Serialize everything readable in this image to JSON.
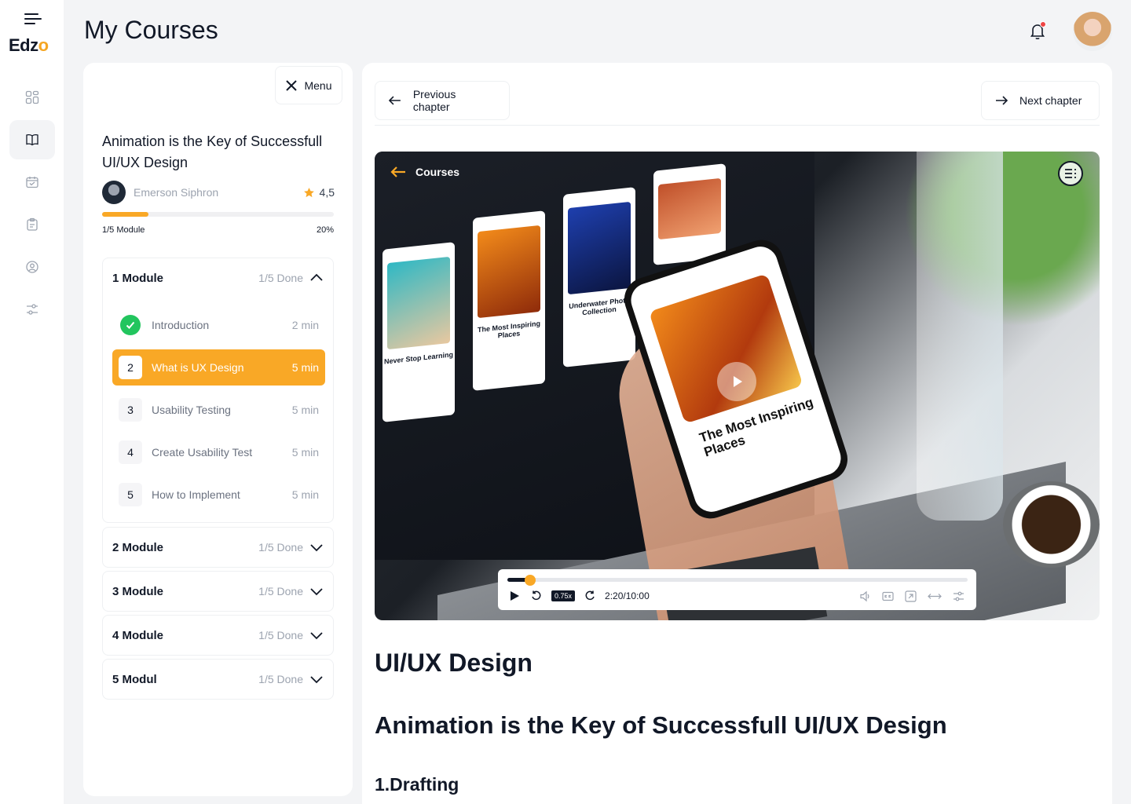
{
  "app": {
    "logo_text": "Edz",
    "logo_accent": "o",
    "page_title": "My Courses",
    "accent_color": "#f9a826"
  },
  "sidebar": {
    "items": [
      {
        "icon": "grid-icon",
        "active": false
      },
      {
        "icon": "book-icon",
        "active": true
      },
      {
        "icon": "calendar-icon",
        "active": false
      },
      {
        "icon": "clipboard-icon",
        "active": false
      },
      {
        "icon": "user-circle-icon",
        "active": false
      },
      {
        "icon": "sliders-icon",
        "active": false
      }
    ]
  },
  "course_panel": {
    "menu_label": "Menu",
    "title": "Animation is the Key of Successfull UI/UX Design",
    "author": "Emerson Siphron",
    "rating": "4,5",
    "progress_fraction": 0.2,
    "progress_left": "1/5 Module",
    "progress_right": "20%",
    "modules": [
      {
        "name": "1 Module",
        "done": "1/5 Done",
        "expanded": true,
        "lessons": [
          {
            "num": "",
            "title": "Introduction",
            "time": "2 min",
            "state": "completed"
          },
          {
            "num": "2",
            "title": "What is UX Design",
            "time": "5 min",
            "state": "active"
          },
          {
            "num": "3",
            "title": "Usability Testing",
            "time": "5 min",
            "state": "pending"
          },
          {
            "num": "4",
            "title": "Create Usability Test",
            "time": "5 min",
            "state": "pending"
          },
          {
            "num": "5",
            "title": "How to Implement",
            "time": "5 min",
            "state": "pending"
          }
        ]
      },
      {
        "name": "2 Module",
        "done": "1/5 Done",
        "expanded": false
      },
      {
        "name": "3 Module",
        "done": "1/5 Done",
        "expanded": false
      },
      {
        "name": "4 Module",
        "done": "1/5 Done",
        "expanded": false
      },
      {
        "name": "5 Modul",
        "done": "1/5 Done",
        "expanded": false
      }
    ]
  },
  "main": {
    "prev_label": "Previous chapter",
    "next_label": "Next chapter",
    "video": {
      "back_label": "Courses",
      "speed": "0.75x",
      "time": "2:20/10:00",
      "progress_fraction": 0.05,
      "phone_text": "The Most Inspiring Places",
      "card_texts": [
        "Never Stop Learning",
        "The Most Inspiring Places",
        "Underwater Photo Collection"
      ]
    },
    "heading_1": "UI/UX Design",
    "heading_2": "Animation is the Key of Successfull UI/UX Design",
    "heading_3": "1.Drafting"
  }
}
